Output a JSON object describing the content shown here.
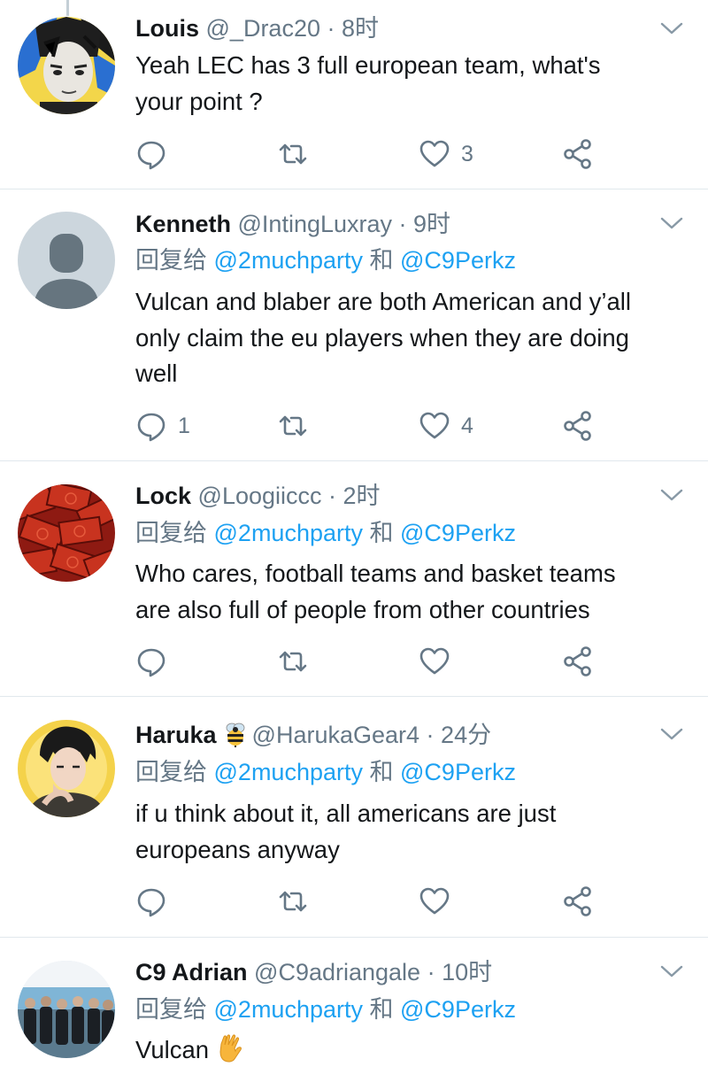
{
  "tweets": [
    {
      "name": "Louis",
      "handle": "@_Drac20",
      "separator": " · ",
      "time": "8时",
      "reply_prefix": "",
      "reply_mention_1": "",
      "reply_and": "",
      "reply_mention_2": "",
      "text_lines": [
        "Yeah LEC has 3 full european team, what's",
        "your point ?"
      ],
      "reply_count": "",
      "retweet_count": "",
      "like_count": "3",
      "avatar": "anime-character-avatar"
    },
    {
      "name": "Kenneth",
      "handle": "@IntingLuxray",
      "separator": " · ",
      "time": "9时",
      "reply_prefix": "回复给 ",
      "reply_mention_1": "@2muchparty",
      "reply_and": " 和 ",
      "reply_mention_2": "@C9Perkz",
      "text_lines": [
        "Vulcan and blaber are both American and y’all",
        "only claim the eu players when they are doing",
        "well"
      ],
      "reply_count": "1",
      "retweet_count": "",
      "like_count": "4",
      "avatar": "default-user-avatar"
    },
    {
      "name": "Lock",
      "handle": "@Loogiiccc",
      "separator": " · ",
      "time": "2时",
      "reply_prefix": "回复给 ",
      "reply_mention_1": "@2muchparty",
      "reply_and": " 和 ",
      "reply_mention_2": "@C9Perkz",
      "text_lines": [
        "Who cares, football teams and basket teams",
        "are also full of people from other countries"
      ],
      "reply_count": "",
      "retweet_count": "",
      "like_count": "",
      "avatar": "red-banknotes-avatar"
    },
    {
      "name": "Haruka",
      "handle": "@HarukaGear4",
      "separator": " · ",
      "time": "24分",
      "reply_prefix": "回复给 ",
      "reply_mention_1": "@2muchparty",
      "reply_and": " 和 ",
      "reply_mention_2": "@C9Perkz",
      "text_lines": [
        "if u think about it, all americans are just",
        "europeans anyway"
      ],
      "reply_count": "",
      "retweet_count": "",
      "like_count": "",
      "avatar": "anime-boy-avatar",
      "name_badge": "bee-emoji"
    },
    {
      "name": "C9 Adrian",
      "handle": "@C9adriangale",
      "separator": " · ",
      "time": "10时",
      "reply_prefix": "回复给 ",
      "reply_mention_1": "@2muchparty",
      "reply_and": " 和 ",
      "reply_mention_2": "@C9Perkz",
      "text_lines": [
        "Vulcan"
      ],
      "text_emoji": "vulcan-salute-emoji",
      "reply_count": "",
      "retweet_count": "",
      "like_count": "",
      "avatar": "team-photo-avatar"
    }
  ],
  "colors": {
    "text_primary": "#14171a",
    "text_secondary": "#657786",
    "mention": "#1da1f2",
    "divider": "#e1e8ed"
  }
}
